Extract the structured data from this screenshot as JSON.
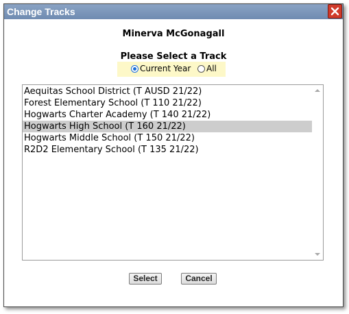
{
  "dialog": {
    "title": "Change Tracks",
    "user_name": "Minerva McGonagall",
    "heading": "Please Select a Track"
  },
  "radio": {
    "options": [
      {
        "label": "Current Year",
        "checked": true
      },
      {
        "label": "All",
        "checked": false
      }
    ]
  },
  "tracks": {
    "items": [
      "Aequitas School District (T AUSD 21/22)",
      "Forest Elementary School (T 110 21/22)",
      "Hogwarts Charter Academy (T 140 21/22)",
      "Hogwarts High School (T 160 21/22)",
      "Hogwarts Middle School (T 150 21/22)",
      "R2D2 Elementary School (T 135 21/22)"
    ],
    "selected": "Hogwarts High School (T 160 21/22)"
  },
  "buttons": {
    "select_label": "Select",
    "cancel_label": "Cancel"
  },
  "icons": {
    "close": "close-icon",
    "scroll_up": "scroll-up-arrow-icon",
    "scroll_down": "scroll-down-arrow-icon"
  },
  "colors": {
    "titlebar": "#7b95ba",
    "close_button": "#d03a2a",
    "radio_highlight": "#fdf8c8",
    "selected_row": "#cdcdcd",
    "radio_accent": "#1a6ed8"
  }
}
